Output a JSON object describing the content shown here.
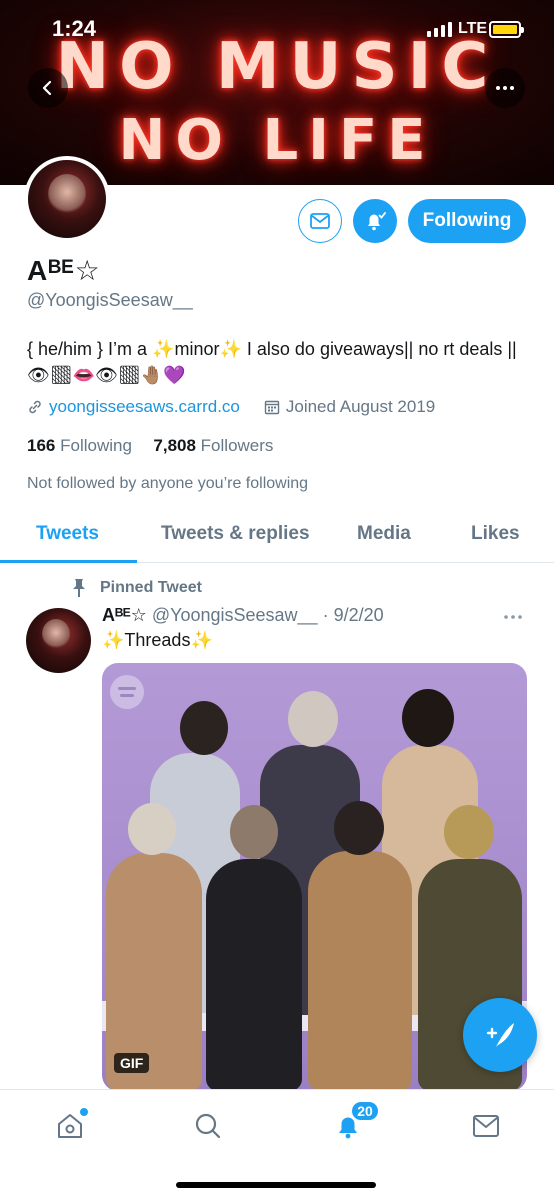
{
  "status_bar": {
    "time": "1:24",
    "network": "LTE"
  },
  "header": {
    "banner_line1": "NO MUSIC",
    "banner_line2": "NO LIFE",
    "back_icon": "chevron-left-icon",
    "more_icon": "more-horizontal-icon"
  },
  "profile": {
    "display_name": "Aᴮᴱ☆",
    "handle": "@YoongisSeesaw__",
    "bio": "{ he/him } I’m a ✨minor✨ I also do giveaways|| no rt deals || 👁🏽👄👁🏽🤚🏽💜",
    "website": "yoongisseesaws.carrd.co",
    "joined": "Joined August 2019",
    "following_count": "166",
    "following_label": "Following",
    "followers_count": "7,808",
    "followers_label": "Followers",
    "not_followed_text": "Not followed by anyone you’re following",
    "follow_button": "Following"
  },
  "tabs": [
    {
      "label": "Tweets",
      "active": true
    },
    {
      "label": "Tweets & replies",
      "active": false
    },
    {
      "label": "Media",
      "active": false
    },
    {
      "label": "Likes",
      "active": false
    }
  ],
  "pinned_tweet": {
    "pinned_label": "Pinned Tweet",
    "author_name": "Aᴮᴱ☆",
    "author_handle": "@YoongisSeesaw__",
    "date": "· 9/2/20",
    "text": "✨Threads✨",
    "media_badge": "GIF"
  },
  "bottom_nav": {
    "notification_count": "20"
  },
  "colors": {
    "accent": "#1da1f2",
    "secondary_text": "#657786",
    "link": "#1b95e0"
  }
}
